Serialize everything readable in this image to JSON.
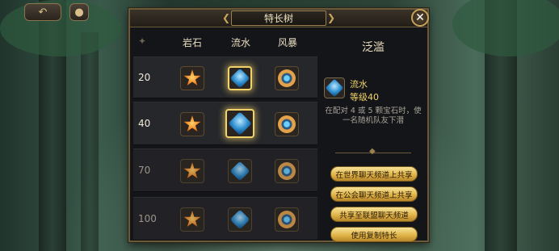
{
  "window": {
    "title": "特长树",
    "close_symbol": "✕"
  },
  "top_buttons": {
    "back_icon": "back-arrow-icon",
    "chat_icon": "chat-bubble-icon"
  },
  "columns": [
    {
      "label": "岩石",
      "icon": "star-gem-icon"
    },
    {
      "label": "流水",
      "icon": "water-gem-icon"
    },
    {
      "label": "风暴",
      "icon": "storm-gem-icon"
    }
  ],
  "rows": [
    {
      "level": "20",
      "state": "unlocked",
      "selected_col": 1
    },
    {
      "level": "40",
      "state": "unlocked",
      "selected_col": 1
    },
    {
      "level": "70",
      "state": "locked",
      "selected_col": null
    },
    {
      "level": "100",
      "state": "locked",
      "selected_col": null
    }
  ],
  "detail": {
    "title": "泛滥",
    "name": "流水",
    "level": "等级40",
    "description": "在配对 4 或 5 颗宝石时，使一名随机队友下潜"
  },
  "actions": {
    "share_world": "在世界聊天频道上共享",
    "share_guild": "在公会聊天频道上共享",
    "share_alliance": "共享至联盟聊天频道",
    "use_copy": "使用复制特长"
  },
  "colors": {
    "gold_accent": "#f0d36a",
    "frame": "#6b5a3a",
    "panel_bg": "#141518"
  }
}
